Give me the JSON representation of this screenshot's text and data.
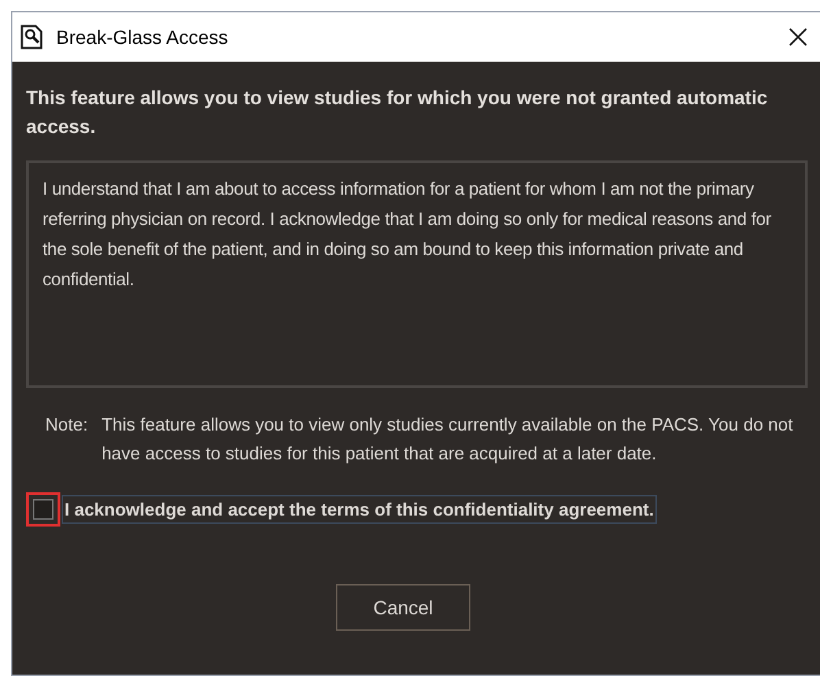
{
  "window": {
    "title": "Break-Glass Access"
  },
  "intro": "This feature allows you to view studies for which you were not granted automatic access.",
  "agreement_text": "I understand that I am about to access information for a patient for whom I am not the primary referring physician on record. I acknowledge that I am doing so only for medical reasons and for the sole benefit of the patient, and in doing so am bound to keep this information private and confidential.",
  "note": {
    "label": "Note:",
    "text": "This feature allows you to view only studies currently available on the PACS. You do not have access to studies for this patient that are acquired at a later date."
  },
  "acknowledge": {
    "label": "I acknowledge and accept the terms of this confidentiality agreement.",
    "checked": false,
    "highlighted": true
  },
  "buttons": [
    "Cancel"
  ]
}
